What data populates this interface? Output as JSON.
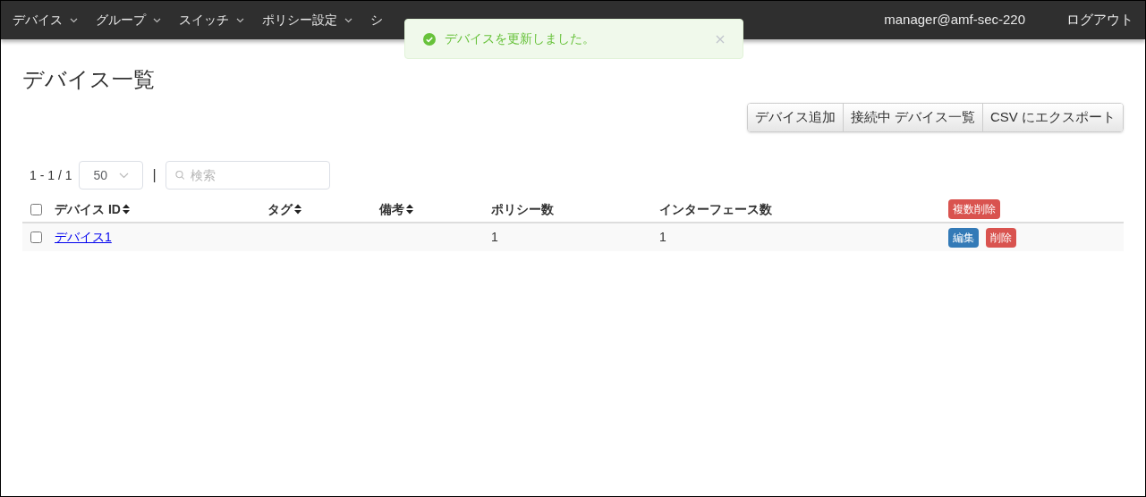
{
  "nav": {
    "items": [
      {
        "label": "デバイス",
        "dropdown": true
      },
      {
        "label": "グループ",
        "dropdown": true
      },
      {
        "label": "スイッチ",
        "dropdown": true
      },
      {
        "label": "ポリシー設定",
        "dropdown": true
      },
      {
        "label": "シ",
        "dropdown": false
      }
    ],
    "user": "manager@amf-sec-220",
    "logout": "ログアウト"
  },
  "toast": {
    "message": "デバイスを更新しました。",
    "kind": "success"
  },
  "title": "デバイス一覧",
  "actions": [
    "デバイス追加",
    "接続中 デバイス一覧",
    "CSV にエクスポート"
  ],
  "pager": {
    "range": "1 - 1 / 1",
    "page_size": "50",
    "separator": "|",
    "search_placeholder": "検索"
  },
  "table": {
    "columns": [
      {
        "label": "デバイス ID",
        "sortable": true
      },
      {
        "label": "タグ",
        "sortable": true
      },
      {
        "label": "備考",
        "sortable": true
      },
      {
        "label": "ポリシー数",
        "sortable": false
      },
      {
        "label": "インターフェース数",
        "sortable": false
      }
    ],
    "select_all_checked": false,
    "bulk_delete": "複数削除",
    "rows": [
      {
        "checked": false,
        "device_id": "デバイス1",
        "tag": "",
        "note": "",
        "policies": "1",
        "interfaces": "1",
        "edit": "編集",
        "delete": "削除"
      }
    ]
  }
}
